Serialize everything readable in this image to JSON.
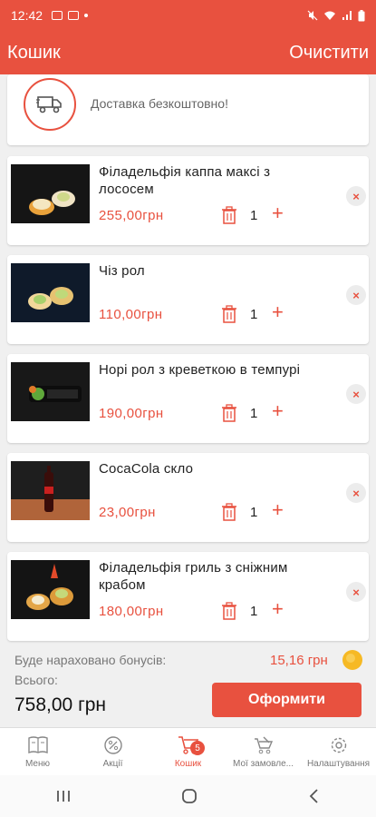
{
  "status_bar": {
    "time": "12:42",
    "left_icons": [
      "image-icon",
      "message-icon",
      "dot-icon"
    ],
    "right_icons": [
      "mute-icon",
      "wifi-icon",
      "signal-icon",
      "battery-icon"
    ]
  },
  "app_bar": {
    "title": "Кошик",
    "clear_label": "Очистити"
  },
  "delivery": {
    "icon": "truck-icon",
    "text": "Доставка безкоштовно!"
  },
  "cart_items": [
    {
      "title": "Філадельфія каппа максі з лососем",
      "price": "255,00грн",
      "quantity": "1"
    },
    {
      "title": "Чіз рол",
      "price": "110,00грн",
      "quantity": "1"
    },
    {
      "title": "Норі рол з креветкою в темпурі",
      "price": "190,00грн",
      "quantity": "1"
    },
    {
      "title": "CocaCola скло",
      "price": "23,00грн",
      "quantity": "1"
    },
    {
      "title": "Філадельфія гриль з сніжним крабом",
      "price": "180,00грн",
      "quantity": "1"
    }
  ],
  "item_controls": {
    "plus": "+",
    "remove": "×"
  },
  "summary": {
    "bonus_label": "Буде нараховано бонусів:",
    "bonus_value": "15,16 грн",
    "total_label": "Всього:",
    "total_value": "758,00 грн",
    "checkout_label": "Оформити"
  },
  "bottom_nav": {
    "items": [
      {
        "label": "Меню",
        "icon": "menu-book-icon"
      },
      {
        "label": "Акції",
        "icon": "percent-icon"
      },
      {
        "label": "Кошик",
        "icon": "cart-icon",
        "badge": "5",
        "active": true
      },
      {
        "label": "Мої замовле...",
        "icon": "orders-icon"
      },
      {
        "label": "Налаштування",
        "icon": "settings-icon"
      }
    ]
  },
  "colors": {
    "accent": "#e8513f",
    "background": "#f0f0f0",
    "coin": "#f6b924"
  }
}
